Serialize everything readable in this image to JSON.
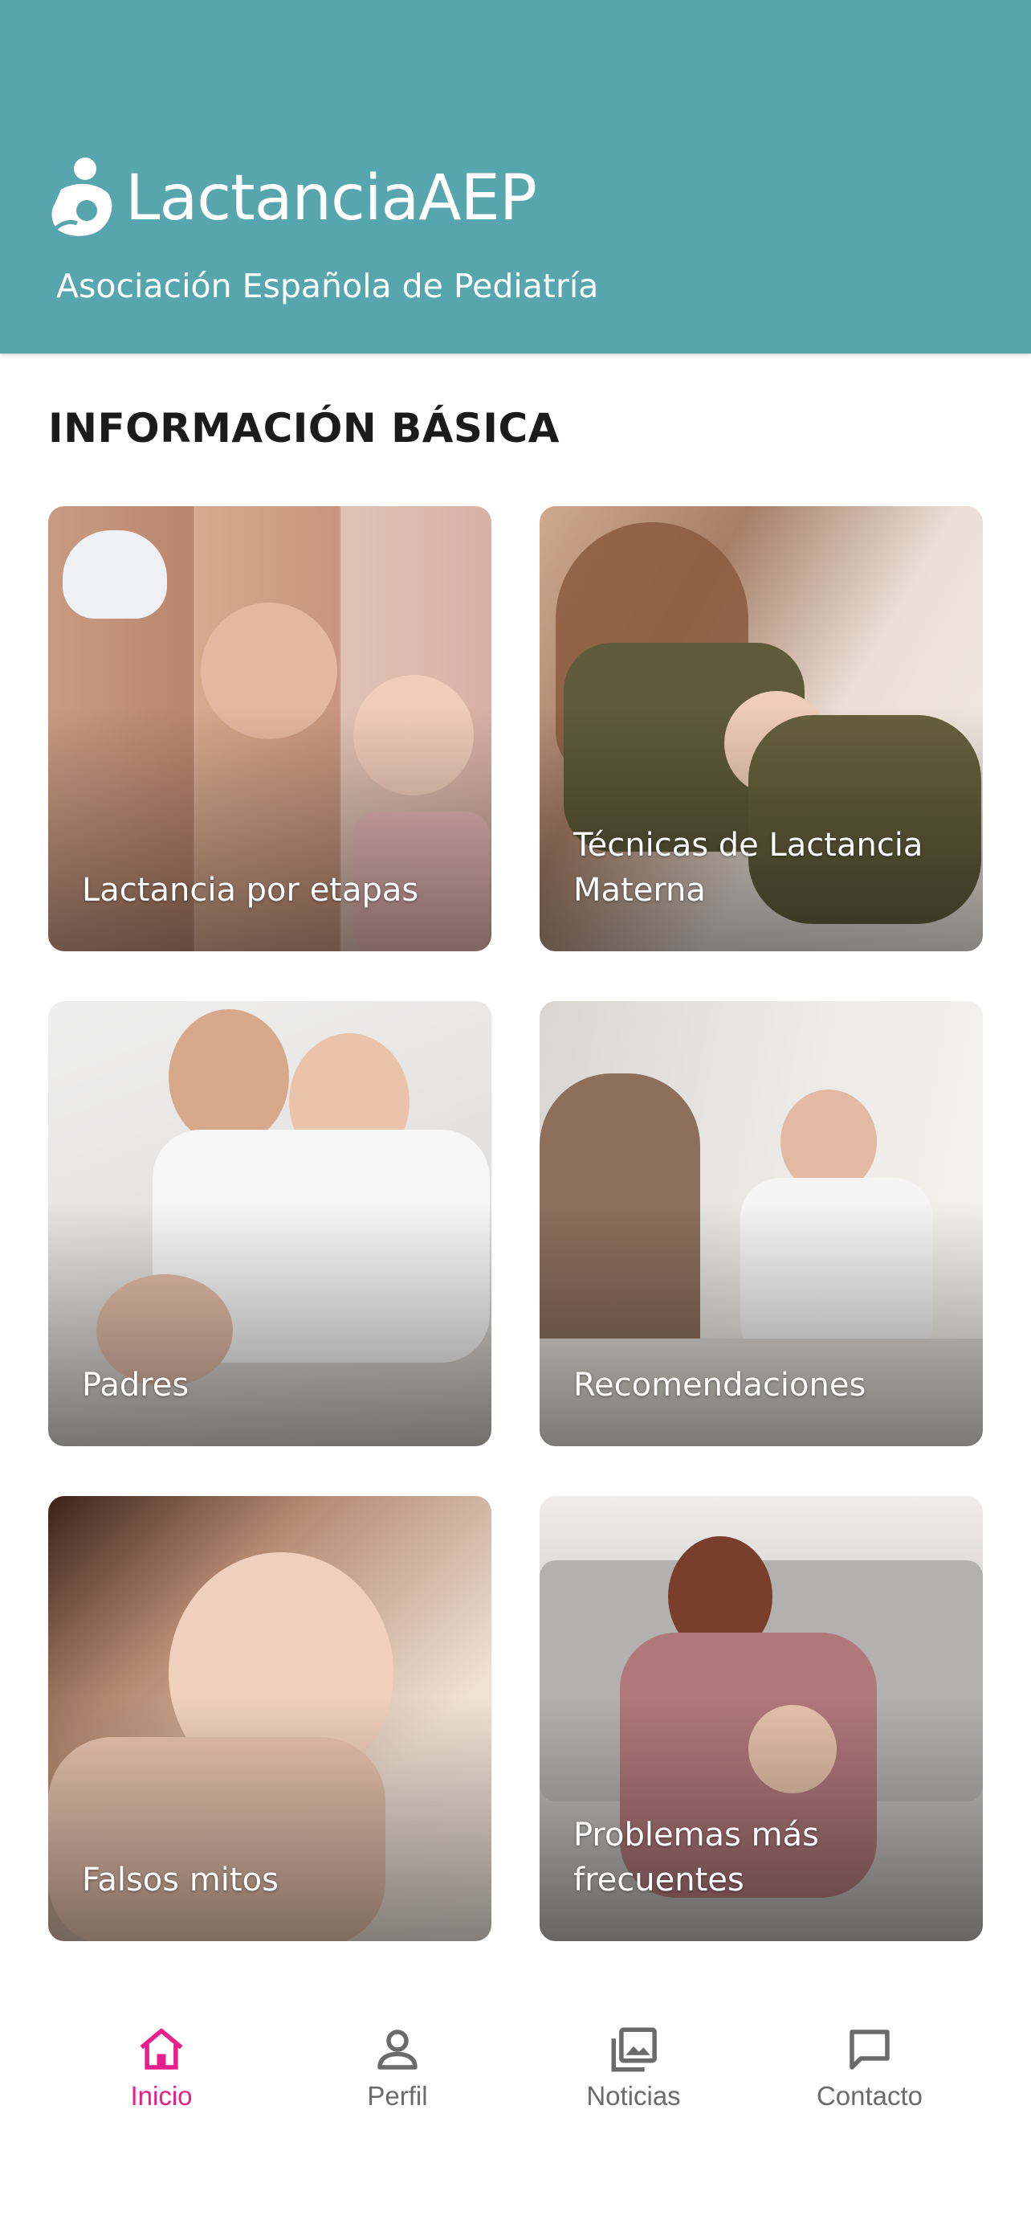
{
  "app": {
    "title": "LactanciaAEP",
    "subtitle": "Asociación Española de Pediatría"
  },
  "section": {
    "title": "INFORMACIÓN BÁSICA"
  },
  "cards": [
    {
      "label": "Lactancia por etapas",
      "image": "newborn-to-toddler-collage"
    },
    {
      "label": "Técnicas de Lactancia Materna",
      "image": "mother-breastfeeding-photo"
    },
    {
      "label": "Padres",
      "image": "parents-with-baby-photo"
    },
    {
      "label": "Recomendaciones",
      "image": "doctor-consultation-photo"
    },
    {
      "label": "Falsos mitos",
      "image": "baby-close-up-photo"
    },
    {
      "label": "Problemas más frecuentes",
      "image": "tired-mother-photo"
    }
  ],
  "nav": {
    "items": [
      {
        "label": "Inicio",
        "icon": "home-icon",
        "active": true
      },
      {
        "label": "Perfil",
        "icon": "person-icon",
        "active": false
      },
      {
        "label": "Noticias",
        "icon": "photo-library-icon",
        "active": false
      },
      {
        "label": "Contacto",
        "icon": "chat-icon",
        "active": false
      }
    ]
  },
  "colors": {
    "header": "#57a6ae",
    "accent": "#e91e8c",
    "nav_inactive": "#6b6b6b"
  }
}
